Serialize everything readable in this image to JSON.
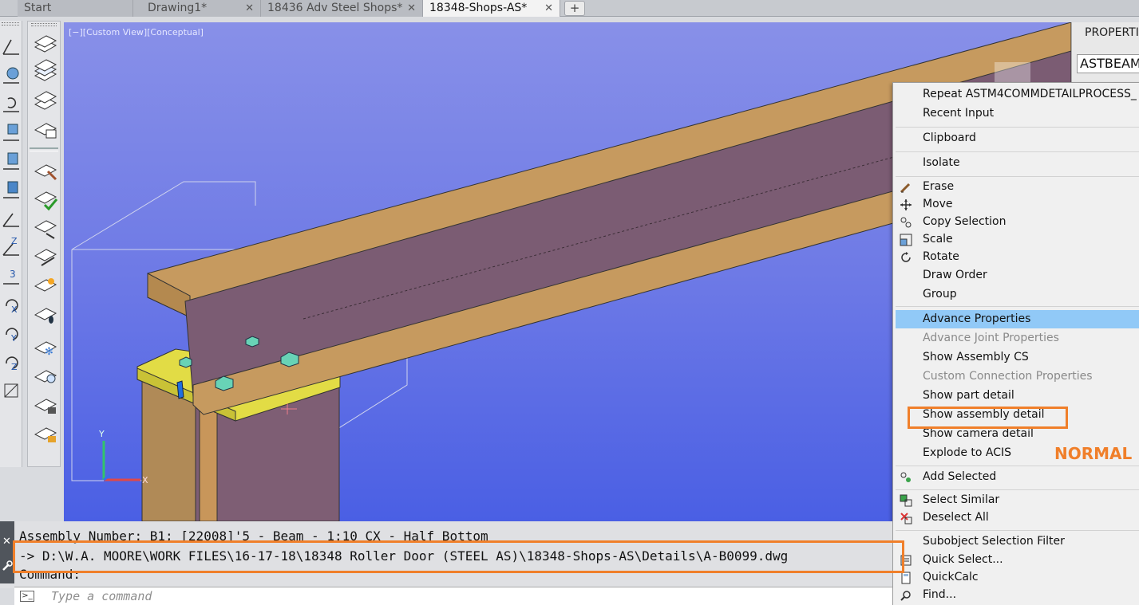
{
  "tabs": [
    {
      "label": "Start",
      "closable": false
    },
    {
      "label": "Drawing1*",
      "closable": true
    },
    {
      "label": "18436 Adv Steel Shops*",
      "closable": true
    },
    {
      "label": "18348-Shops-AS*",
      "closable": true,
      "active": true
    }
  ],
  "tab_add_label": "+",
  "tab_close_glyph": "✕",
  "viewport": {
    "label": "[−][Custom View][Conceptual]",
    "axis_labels": {
      "y": "Y",
      "x": "X"
    },
    "background_top": "#8890e8",
    "background_bottom": "#4a5fe4"
  },
  "properties": {
    "title": "PROPERTIES",
    "selected_type": "ASTBEAM"
  },
  "context_menu": {
    "items": [
      {
        "label": "Repeat ASTM4COMMDETAILPROCESS_",
        "enabled": true
      },
      {
        "label": "Recent Input",
        "enabled": true
      },
      {
        "label": "Clipboard",
        "enabled": true
      },
      {
        "label": "Isolate",
        "enabled": true
      },
      {
        "label": "Erase",
        "enabled": true,
        "icon": "erase-icon"
      },
      {
        "label": "Move",
        "enabled": true,
        "icon": "move-icon"
      },
      {
        "label": "Copy Selection",
        "enabled": true,
        "icon": "copy-icon"
      },
      {
        "label": "Scale",
        "enabled": true,
        "icon": "scale-icon"
      },
      {
        "label": "Rotate",
        "enabled": true,
        "icon": "rotate-icon"
      },
      {
        "label": "Draw Order",
        "enabled": true
      },
      {
        "label": "Group",
        "enabled": true
      },
      {
        "label": "Advance Properties",
        "enabled": true,
        "highlighted": true
      },
      {
        "label": "Advance Joint Properties",
        "enabled": false
      },
      {
        "label": "Show Assembly CS",
        "enabled": true
      },
      {
        "label": "Custom Connection Properties",
        "enabled": false
      },
      {
        "label": "Show part detail",
        "enabled": true
      },
      {
        "label": "Show assembly detail",
        "enabled": true,
        "annotated": true
      },
      {
        "label": "Show camera detail",
        "enabled": true
      },
      {
        "label": "Explode to ACIS",
        "enabled": true
      },
      {
        "label": "Add Selected",
        "enabled": true,
        "icon": "add-selected-icon"
      },
      {
        "label": "Select Similar",
        "enabled": true,
        "icon": "select-similar-icon"
      },
      {
        "label": "Deselect All",
        "enabled": true,
        "icon": "deselect-icon"
      },
      {
        "label": "Subobject Selection Filter",
        "enabled": true
      },
      {
        "label": "Quick Select...",
        "enabled": true,
        "icon": "quick-select-icon"
      },
      {
        "label": "QuickCalc",
        "enabled": true,
        "icon": "calculator-icon"
      },
      {
        "label": "Find...",
        "enabled": true,
        "icon": "find-icon"
      }
    ]
  },
  "annotation_label": "NORMAL",
  "annotation_color": "#f07f2a",
  "command_history": {
    "line1": "Assembly Number: B1; [22008]'5 - Beam - 1:10 CX - Half Bottom",
    "line2": "-> D:\\W.A. MOORE\\WORK FILES\\16-17-18\\18348 Roller Door (STEEL AS)\\18348-Shops-AS\\Details\\A-B0099.dwg",
    "line3": "Command:"
  },
  "command_input": {
    "placeholder": "Type a command",
    "prompt_glyph": ">_"
  },
  "side_glyphs": {
    "close": "✕",
    "settings": "🔧"
  }
}
